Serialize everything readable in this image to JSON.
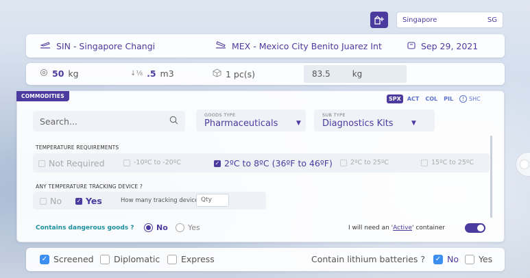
{
  "location": {
    "city": "Singapore",
    "code": "SG"
  },
  "route": {
    "origin": "SIN - Singapore Changi",
    "destination": "MEX - Mexico City Benito Juarez Int",
    "date": "Sep 29, 2021"
  },
  "shipment": {
    "weight_value": "50",
    "weight_unit": "kg",
    "volume_value": ".5",
    "volume_unit": "m3",
    "pieces": "1 pc(s)",
    "chargeable_value": "83.5",
    "chargeable_unit": "kg"
  },
  "commodities": {
    "tag": "COMMODITIES",
    "handling_codes": [
      "SPX",
      "ACT",
      "COL",
      "PIL"
    ],
    "active_code": "SPX",
    "shc_label": "SHC",
    "search_placeholder": "Search...",
    "goods_type_label": "GOODS TYPE",
    "goods_type_value": "Pharmaceuticals",
    "sub_type_label": "SUB TYPE",
    "sub_type_value": "Diagnostics Kits",
    "temp_label": "TEMPERATURE REQUIREMENTS",
    "temp_options": [
      {
        "label": "Not Required",
        "checked": false
      },
      {
        "label": "-10ºC to -20ºC",
        "checked": false
      },
      {
        "label": "2ºC to 8ºC (36ºF to 46ºF)",
        "checked": true
      },
      {
        "label": "2ºC to 25ºC",
        "checked": false
      },
      {
        "label": "15ºC to 25ºC",
        "checked": false
      }
    ],
    "tracking_label": "ANY TEMPERATURE TRACKING DEVICE ?",
    "tracking_no": "No",
    "tracking_yes": "Yes",
    "tracking_yes_checked": true,
    "tracking_count_label": "How many tracking devices?",
    "qty_placeholder": "Qty",
    "dg_label": "Contains dangerous goods ?",
    "dg_no": "No",
    "dg_yes": "Yes",
    "dg_selected": "No",
    "active_text_pre": "I will need an '",
    "active_text_link": "Active",
    "active_text_post": "' container",
    "active_enabled": true
  },
  "bottom": {
    "screened": "Screened",
    "screened_checked": true,
    "diplomatic": "Diplomatic",
    "express": "Express",
    "lithium_label": "Contain lithium batteries ?",
    "lithium_no": "No",
    "lithium_yes": "Yes",
    "lithium_no_checked": true
  },
  "icons": {
    "location_button": "building-plus-icon",
    "origin": "plane-takeoff-icon",
    "destination": "plane-landing-icon",
    "date": "calendar-icon",
    "weight": "weight-icon",
    "volume": "volume-icon",
    "pieces": "box-icon",
    "search": "search-icon",
    "shc": "info-circle-icon"
  },
  "colors": {
    "accent": "#4b3b9f",
    "teal": "#1a8fa0",
    "check_blue": "#3c8ef0"
  }
}
